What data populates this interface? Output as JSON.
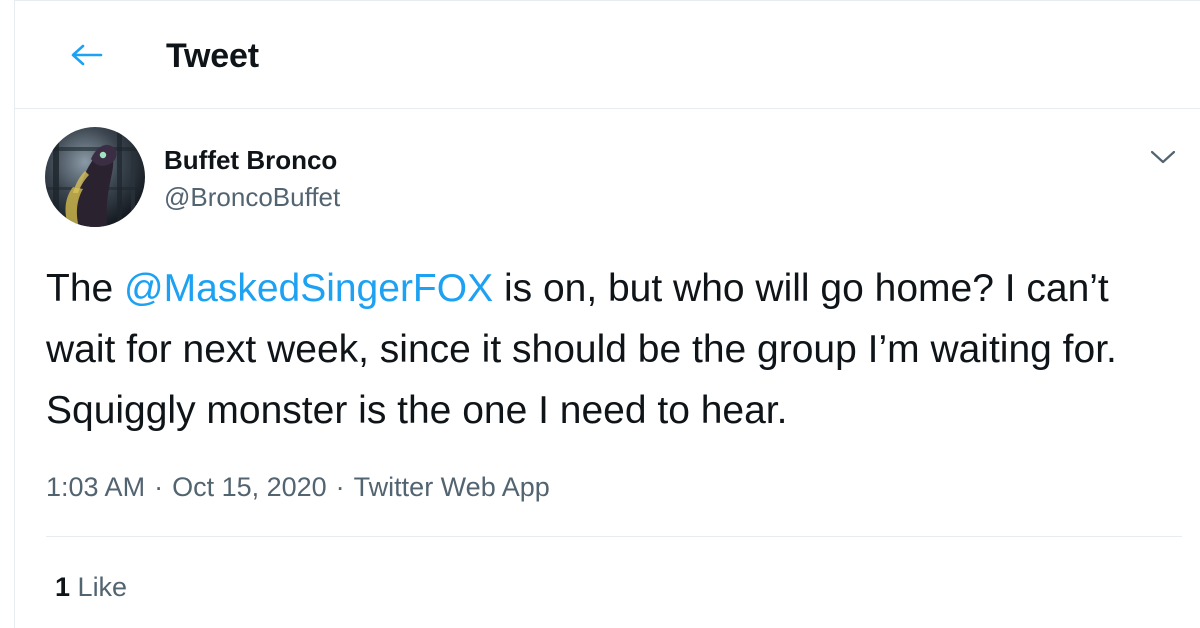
{
  "header": {
    "back_icon": "arrow-left-icon",
    "title": "Tweet"
  },
  "tweet": {
    "author": {
      "display_name": "Buffet Bronco",
      "handle": "@BroncoBuffet",
      "avatar": "avatar-image"
    },
    "more_icon": "chevron-down-icon",
    "text_before_mention": "The ",
    "mention": "@MaskedSingerFOX",
    "text_after_mention": " is on, but who will go home? I can’t wait for next week, since it should be the group I’m waiting for. Squiggly monster is the one I need to hear.",
    "time": "1:03 AM",
    "date": "Oct 15, 2020",
    "separator": "·",
    "source": "Twitter Web App",
    "likes_count": "1",
    "likes_label": "Like"
  },
  "colors": {
    "accent": "#1da1f2",
    "text": "#0f1419",
    "muted": "#536471",
    "border": "#e6ecf0"
  }
}
